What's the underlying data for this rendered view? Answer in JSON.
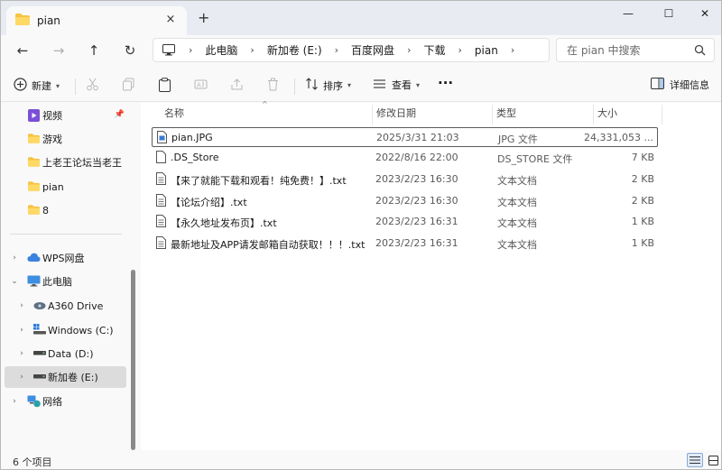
{
  "tab": {
    "title": "pian",
    "close": "×",
    "new_tab": "+"
  },
  "window_controls": {
    "minimize": "—",
    "maximize": "☐",
    "close": "✕"
  },
  "nav": {
    "back": "←",
    "forward": "→",
    "up": "↑",
    "refresh": "↻"
  },
  "breadcrumb": [
    "此电脑",
    "新加卷 (E:)",
    "百度网盘",
    "下载",
    "pian"
  ],
  "breadcrumb_sep": "›",
  "search": {
    "placeholder": "在 pian 中搜索"
  },
  "toolbar": {
    "new_label": "新建",
    "sort_label": "排序",
    "view_label": "查看",
    "more": "···",
    "details_label": "详细信息"
  },
  "sidebar": {
    "quick": [
      {
        "label": "视频",
        "icon": "video-icon",
        "pinned": true
      },
      {
        "label": "游戏",
        "icon": "folder-icon"
      },
      {
        "label": "上老王论坛当老王",
        "icon": "folder-icon"
      },
      {
        "label": "pian",
        "icon": "folder-icon"
      },
      {
        "label": "8",
        "icon": "folder-icon"
      }
    ],
    "tree": [
      {
        "label": "WPS网盘",
        "icon": "cloud-icon",
        "level": 0,
        "expanded": false
      },
      {
        "label": "此电脑",
        "icon": "pc-icon",
        "level": 0,
        "expanded": true
      },
      {
        "label": "A360 Drive",
        "icon": "drive-icon",
        "level": 1,
        "expanded": false
      },
      {
        "label": "Windows (C:)",
        "icon": "windows-drive-icon",
        "level": 1,
        "expanded": false
      },
      {
        "label": "Data (D:)",
        "icon": "drive-icon",
        "level": 1,
        "expanded": false
      },
      {
        "label": "新加卷 (E:)",
        "icon": "drive-icon",
        "level": 1,
        "expanded": false,
        "selected": true
      },
      {
        "label": "网络",
        "icon": "network-icon",
        "level": 0,
        "expanded": false
      }
    ]
  },
  "columns": {
    "name": "名称",
    "date": "修改日期",
    "type": "类型",
    "size": "大小"
  },
  "files": [
    {
      "name": "pian.JPG",
      "date": "2025/3/31 21:03",
      "type": "JPG 文件",
      "size": "24,331,053 ...",
      "icon": "image-file-icon",
      "selected": true
    },
    {
      "name": ".DS_Store",
      "date": "2022/8/16 22:00",
      "type": "DS_STORE 文件",
      "size": "7 KB",
      "icon": "file-icon"
    },
    {
      "name": "【来了就能下载和观看！纯免费！】.txt",
      "date": "2023/2/23 16:30",
      "type": "文本文档",
      "size": "2 KB",
      "icon": "text-file-icon"
    },
    {
      "name": "【论坛介绍】.txt",
      "date": "2023/2/23 16:30",
      "type": "文本文档",
      "size": "2 KB",
      "icon": "text-file-icon"
    },
    {
      "name": "【永久地址发布页】.txt",
      "date": "2023/2/23 16:31",
      "type": "文本文档",
      "size": "1 KB",
      "icon": "text-file-icon"
    },
    {
      "name": "最新地址及APP请发邮箱自动获取！！！.txt",
      "date": "2023/2/23 16:31",
      "type": "文本文档",
      "size": "1 KB",
      "icon": "text-file-icon"
    }
  ],
  "status": {
    "count": "6 个项目"
  },
  "colors": {
    "folder": "#f6c342",
    "accent": "#1f6fd1",
    "selection_row_border": "#5a5a5a"
  }
}
